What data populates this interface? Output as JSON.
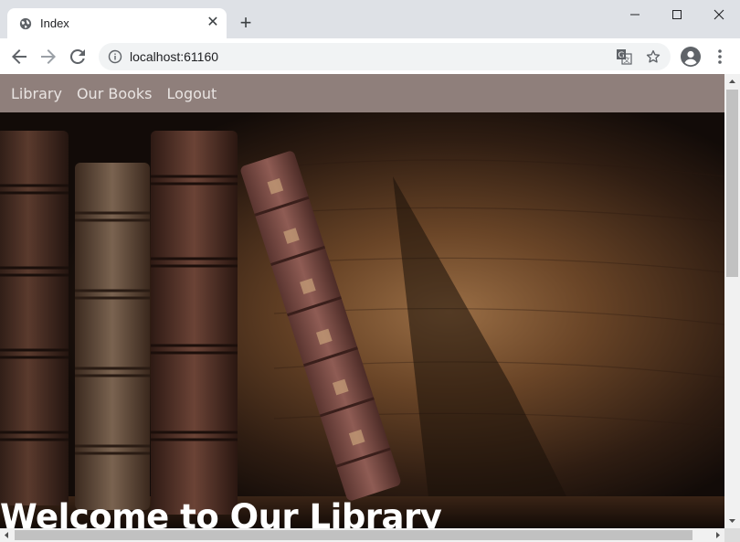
{
  "browser": {
    "tab_title": "Index",
    "url": "localhost:61160"
  },
  "site": {
    "nav": [
      "Library",
      "Our Books",
      "Logout"
    ],
    "hero_title": "Welcome to Our Library"
  },
  "icons": {
    "favicon": "globe-icon",
    "tab_close": "close-icon",
    "new_tab": "plus-icon",
    "back": "arrow-left-icon",
    "forward": "arrow-right-icon",
    "reload": "reload-icon",
    "site_info": "info-icon",
    "translate": "translate-icon",
    "bookmark": "star-icon",
    "account": "account-icon",
    "menu": "kebab-menu-icon"
  },
  "colors": {
    "nav_background": "#8f7f7b",
    "nav_link": "#e9e4e2",
    "chrome_frame": "#dee1e6"
  }
}
